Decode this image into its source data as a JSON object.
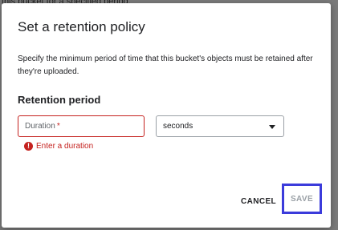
{
  "backdrop": {
    "text": "this bucket for a specified period."
  },
  "dialog": {
    "title": "Set a retention policy",
    "description": "Specify the minimum period of time that this bucket's objects must be retained after they're uploaded.",
    "section_label": "Retention period",
    "duration": {
      "value": "",
      "placeholder": "Duration",
      "required_mark": "*",
      "error": "Enter a duration",
      "error_icon": "error-circle-icon"
    },
    "unit_select": {
      "selected": "seconds",
      "icon": "chevron-down-icon"
    },
    "buttons": {
      "cancel": "CANCEL",
      "save": "SAVE"
    }
  },
  "colors": {
    "error": "#c5221f",
    "focus_outline": "#3b3bdb",
    "disabled_text": "#9aa0a6"
  }
}
